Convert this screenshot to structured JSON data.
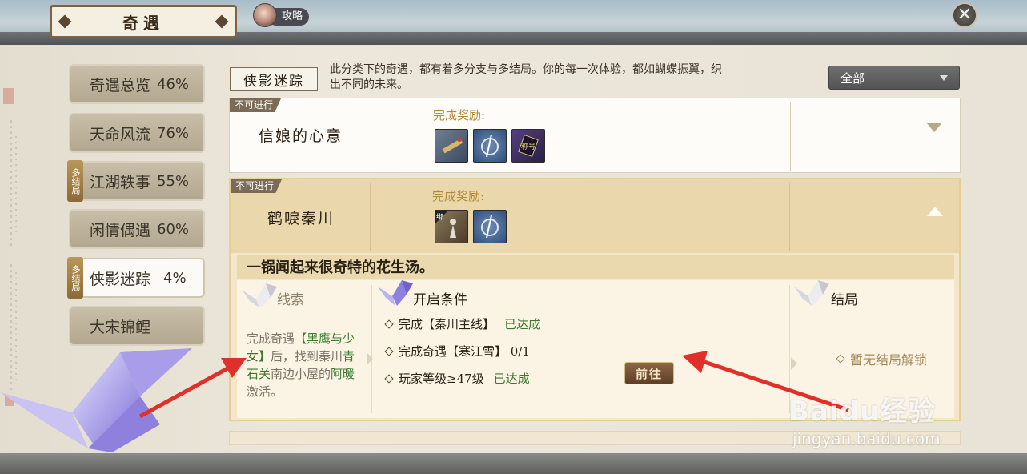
{
  "header": {
    "title": "奇遇",
    "guide_label": "攻略",
    "close_icon": "close-icon"
  },
  "sidebar": {
    "items": [
      {
        "label": "奇遇总览",
        "percent": "46%",
        "tag": ""
      },
      {
        "label": "天命风流",
        "percent": "76%",
        "tag": ""
      },
      {
        "label": "江湖轶事",
        "percent": "55%",
        "tag": "多结局"
      },
      {
        "label": "闲情偶遇",
        "percent": "60%",
        "tag": ""
      },
      {
        "label": "侠影迷踪",
        "percent": "4%",
        "tag": "多结局",
        "active": true
      },
      {
        "label": "大宋锦鲤",
        "percent": "",
        "tag": ""
      }
    ]
  },
  "category": {
    "name": "侠影迷踪",
    "description": "此分类下的奇遇，都有着多分支与多结局。你的每一次体验，都如蝴蝶振翼，织出不同的未来。"
  },
  "filter": {
    "selected": "全部"
  },
  "quests": [
    {
      "status": "不可进行",
      "name": "信娘的心意",
      "reward_label": "完成奖励:",
      "rewards": [
        "scroll-item-icon",
        "hook-item-icon",
        "title-item-icon"
      ]
    },
    {
      "status": "不可进行",
      "name": "鹤唳秦川",
      "reward_label": "完成奖励:",
      "rewards": [
        "bound-figure-item-icon",
        "hook-item-icon"
      ],
      "story": "一锅闻起来很奇特的花生汤。",
      "clue_title": "线索",
      "clue_parts": {
        "p1": "完成奇遇",
        "h1": "【黑鹰与少女】",
        "p2": "后，找到秦川",
        "h2": "青石关",
        "p3": "南边小屋的",
        "h3": "阿暖",
        "p4": "激活。"
      },
      "conditions_title": "开启条件",
      "conditions": [
        {
          "text": "完成【秦川主线】",
          "state": "已达成"
        },
        {
          "text": "完成奇遇【寒江雪】 0/1",
          "state": ""
        },
        {
          "text": "玩家等级≥47级",
          "state": "已达成"
        }
      ],
      "go_label": "前往",
      "ending_title": "结局",
      "ending_text": "暂无结局解锁"
    }
  ],
  "thumb_text": {
    "bound": "绑",
    "title": "称号"
  },
  "watermark": {
    "brand": "Baidu经验",
    "url": "jingyan.baidu.com"
  },
  "colors": {
    "accent_gold": "#b08a3c",
    "achieved_green": "#3d7a30",
    "arrow_red": "#e0302a"
  }
}
